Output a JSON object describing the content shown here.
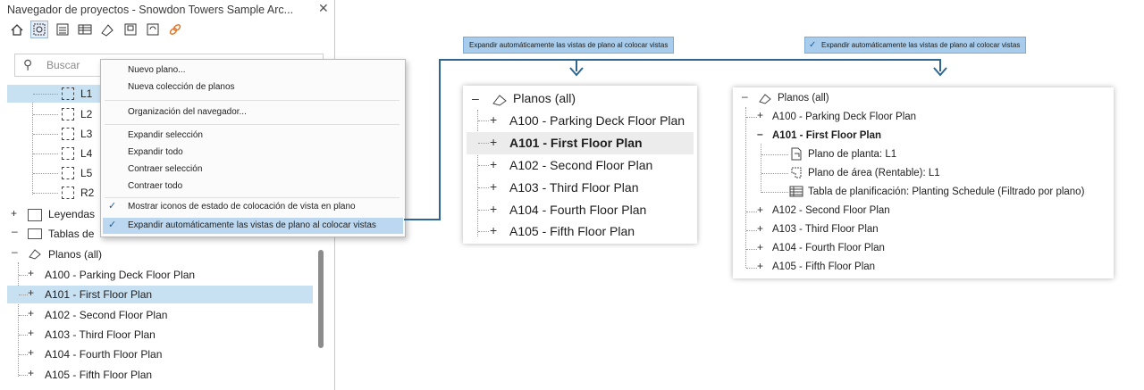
{
  "browser": {
    "title": "Navegador de proyectos - Snowdon Towers Sample Arc...",
    "close": "✕",
    "search_placeholder": "Buscar",
    "views": [
      "L1",
      "L2",
      "L3",
      "L4",
      "L5",
      "R2"
    ],
    "legends_label": "Leyendas",
    "schedules_label": "Tablas de",
    "sheets_group": "Planos (all)",
    "sheets": [
      "A100 - Parking Deck Floor Plan",
      "A101 - First Floor Plan",
      "A102 - Second Floor Plan",
      "A103 - Third Floor Plan",
      "A104 - Fourth Floor Plan",
      "A105 - Fifth Floor Plan"
    ]
  },
  "context_menu": {
    "items": [
      "Nuevo plano...",
      "Nueva colección de planos",
      "Organización del navegador...",
      "Expandir selección",
      "Expandir todo",
      "Contraer selección",
      "Contraer todo",
      "Mostrar iconos de estado de colocación de vista en plano",
      "Expandir automáticamente las vistas de plano al colocar vistas"
    ],
    "checked_mark": "✓"
  },
  "callouts": {
    "left": "Expandir automáticamente las vistas de plano al colocar vistas",
    "right": "Expandir automáticamente las vistas de plano al colocar vistas",
    "right_check": "✓"
  },
  "middle_panel": {
    "group": "Planos (all)",
    "sheets": [
      "A100 - Parking Deck Floor Plan",
      "A101 - First Floor Plan",
      "A102 - Second Floor Plan",
      "A103 - Third Floor Plan",
      "A104 - Fourth Floor Plan",
      "A105 - Fifth Floor Plan"
    ]
  },
  "right_panel": {
    "group": "Planos (all)",
    "sheet_first": "A100 - Parking Deck Floor Plan",
    "sheet_expanded": "A101 - First Floor Plan",
    "children": [
      "Plano de planta: L1",
      "Plano de área (Rentable): L1",
      "Tabla de planificación: Planting Schedule (Filtrado por plano)"
    ],
    "sheets_rest": [
      "A102 - Second Floor Plan",
      "A103 - Third Floor Plan",
      "A104 - Fourth Floor Plan",
      "A105 - Fifth Floor Plan"
    ]
  },
  "colors": {
    "accent": "#2e6690",
    "selection": "#c8e1f2",
    "callout": "#a8cdec"
  }
}
